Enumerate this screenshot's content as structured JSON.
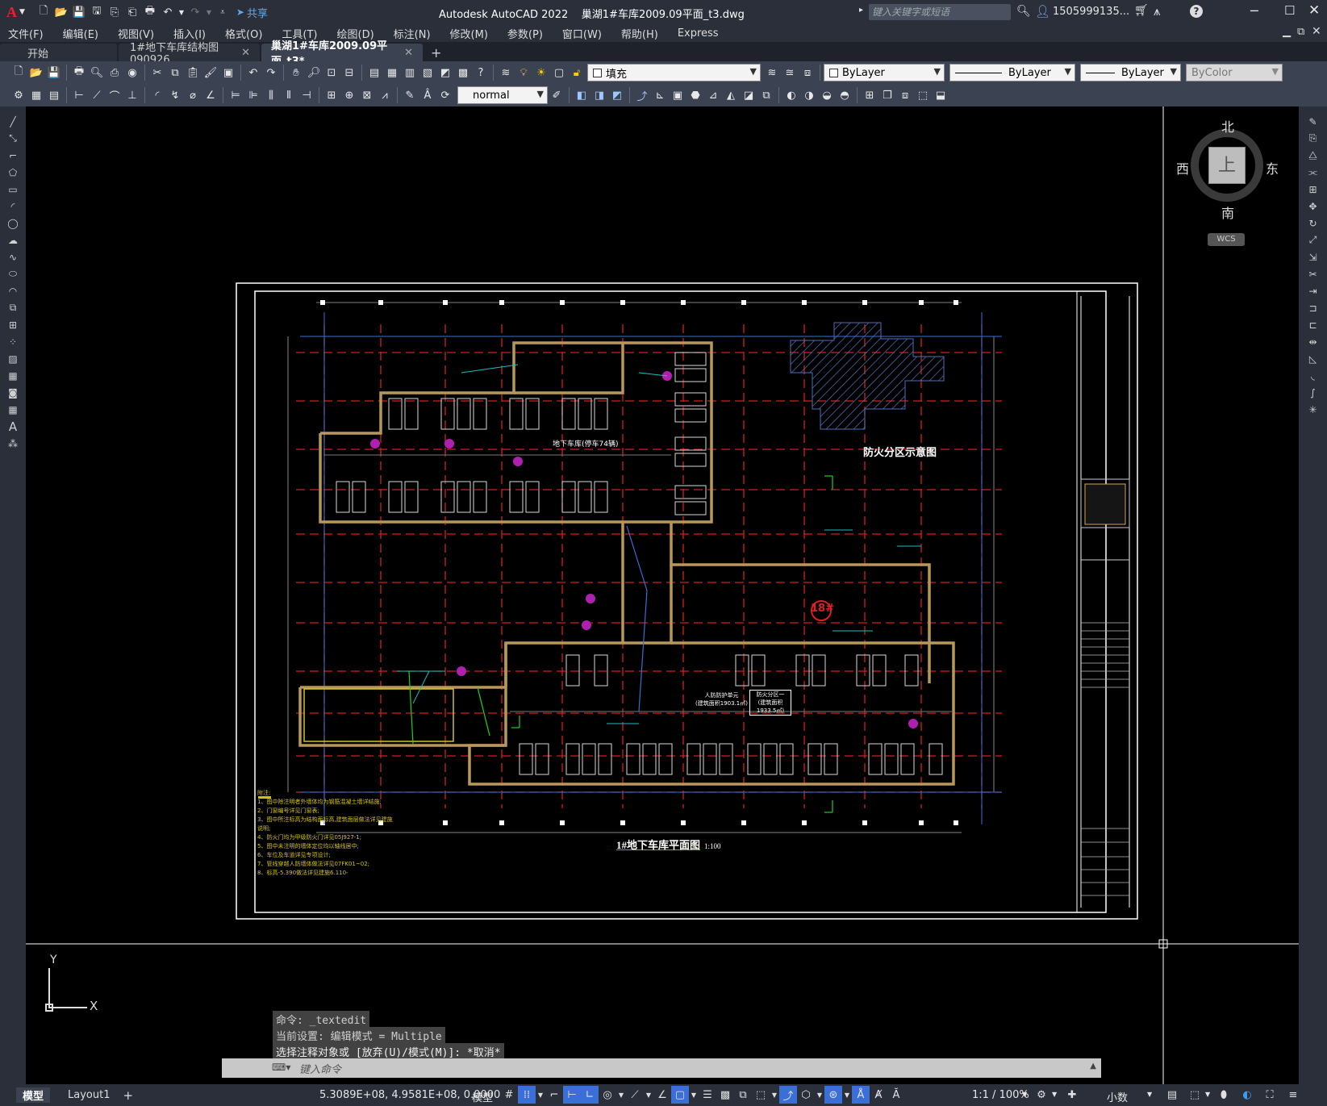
{
  "title": {
    "app_name": "Autodesk AutoCAD 2022",
    "file_name": "巢湖1#车库2009.09平面_t3.dwg",
    "share_label": "共享",
    "search_placeholder": "键入关键字或短语",
    "user": "1505999135...",
    "logo": "A"
  },
  "menu": [
    "文件(F)",
    "编辑(E)",
    "视图(V)",
    "插入(I)",
    "格式(O)",
    "工具(T)",
    "绘图(D)",
    "标注(N)",
    "修改(M)",
    "参数(P)",
    "窗口(W)",
    "帮助(H)",
    "Express"
  ],
  "tabs": [
    {
      "label": "开始"
    },
    {
      "label": "1#地下车库结构图090926"
    },
    {
      "label": "巢湖1#车库2009.09平面_t3*"
    }
  ],
  "toolbar": {
    "layer_value": "填充",
    "color_value": "ByLayer",
    "linetype_value": "ByLayer",
    "lineweight_value": "ByLayer",
    "plotstyle_value": "ByColor",
    "textstyle_value": "normal"
  },
  "viewcube": {
    "north": "北",
    "south": "南",
    "east": "东",
    "west": "西",
    "top": "上",
    "wcs": "WCS"
  },
  "drawing": {
    "main_title": "1#地下车库平面图",
    "scale": "1:100",
    "fire_zone_title": "防火分区示意图",
    "unit_18": "18#",
    "ramp_label": "地下车库(停车74辆)",
    "shelter_1": "人防防护单元",
    "shelter_1_area": "(建筑面积1903.1㎡)",
    "shelter_2": "防火分区一",
    "shelter_2_area": "(建筑面积1933.5㎡)",
    "notes_title": "附注:",
    "notes": [
      "1、图中除注明者外墙体均为钢筋混凝土墙详结施;",
      "2、门窗编号详见门窗表;",
      "3、图中所注标高为结构面标高,建筑面层做法详见建施说明;",
      "4、防火门均为甲级防火门详见05J927-1;",
      "5、图中未注明的墙体定位均以轴线居中;",
      "6、车位及车道详见专项设计;",
      "7、管线穿越人防墙体做法详见07FK01~02;",
      "8、标高-5.390做法详见建施6.110-"
    ]
  },
  "command": {
    "history": [
      "命令: _textedit",
      "当前设置: 编辑模式 = Multiple",
      "选择注释对象或 [放弃(U)/模式(M)]: *取消*"
    ],
    "placeholder": "键入命令"
  },
  "ucs": {
    "x": "X",
    "y": "Y"
  },
  "status": {
    "model_tab": "模型",
    "layout_tab": "Layout1",
    "coordinates": "5.3089E+08, 4.9581E+08, 0.0000",
    "space": "模型",
    "scale": "1:1 / 100%",
    "units": "小数"
  }
}
